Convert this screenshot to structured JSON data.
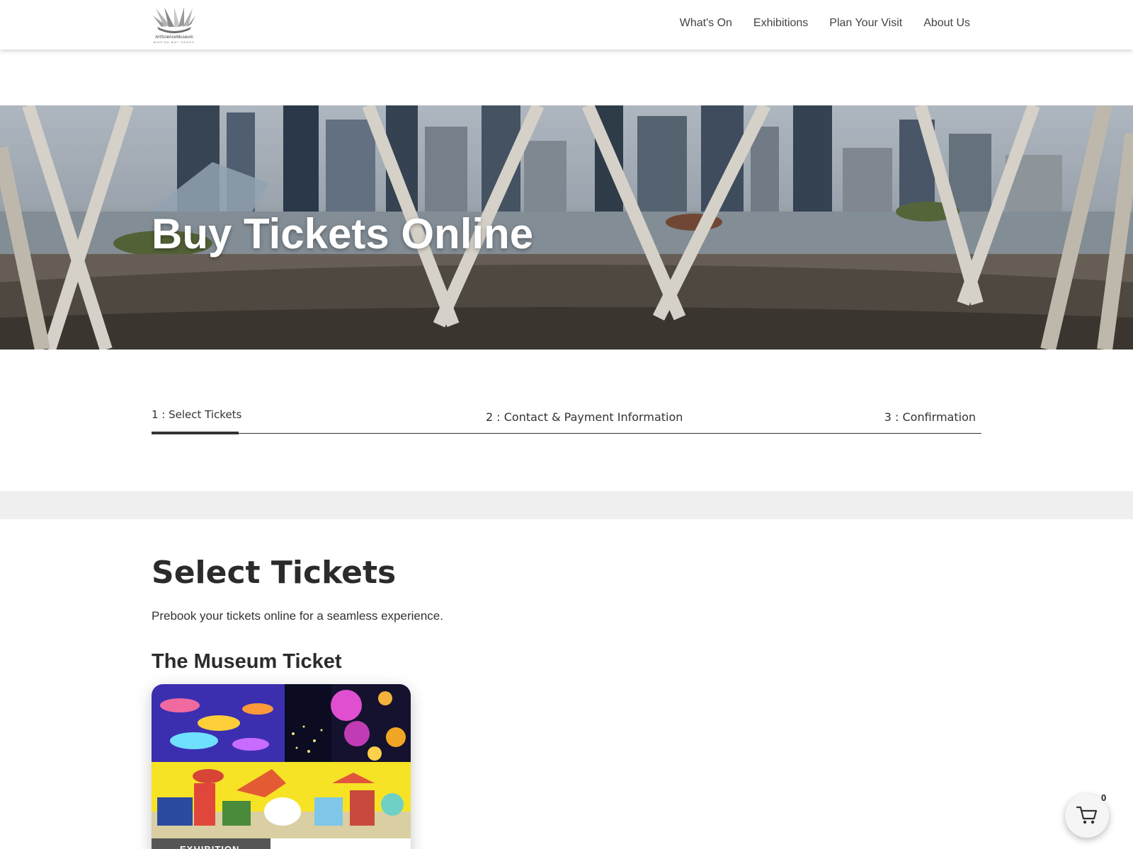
{
  "header": {
    "logo": {
      "name": "ArtScienceMuseum",
      "sub": "MARINA BAY SANDS"
    },
    "nav": [
      {
        "label": "What's On"
      },
      {
        "label": "Exhibitions"
      },
      {
        "label": "Plan Your Visit"
      },
      {
        "label": "About Us"
      }
    ]
  },
  "hero": {
    "title": "Buy Tickets Online"
  },
  "steps": [
    {
      "label": "1 : Select Tickets",
      "active": true
    },
    {
      "label": "2 : Contact & Payment Information",
      "active": false
    },
    {
      "label": "3 : Confirmation",
      "active": false
    }
  ],
  "content": {
    "title": "Select Tickets",
    "description": "Prebook your tickets online for a seamless experience.",
    "section_title": "The Museum Ticket",
    "card_badge": "EXHIBITION"
  },
  "cart": {
    "count": "0",
    "icon": "shopping-cart-icon"
  },
  "colors": {
    "text": "#2b2b2b",
    "band": "#efefef",
    "badge": "#555555"
  }
}
